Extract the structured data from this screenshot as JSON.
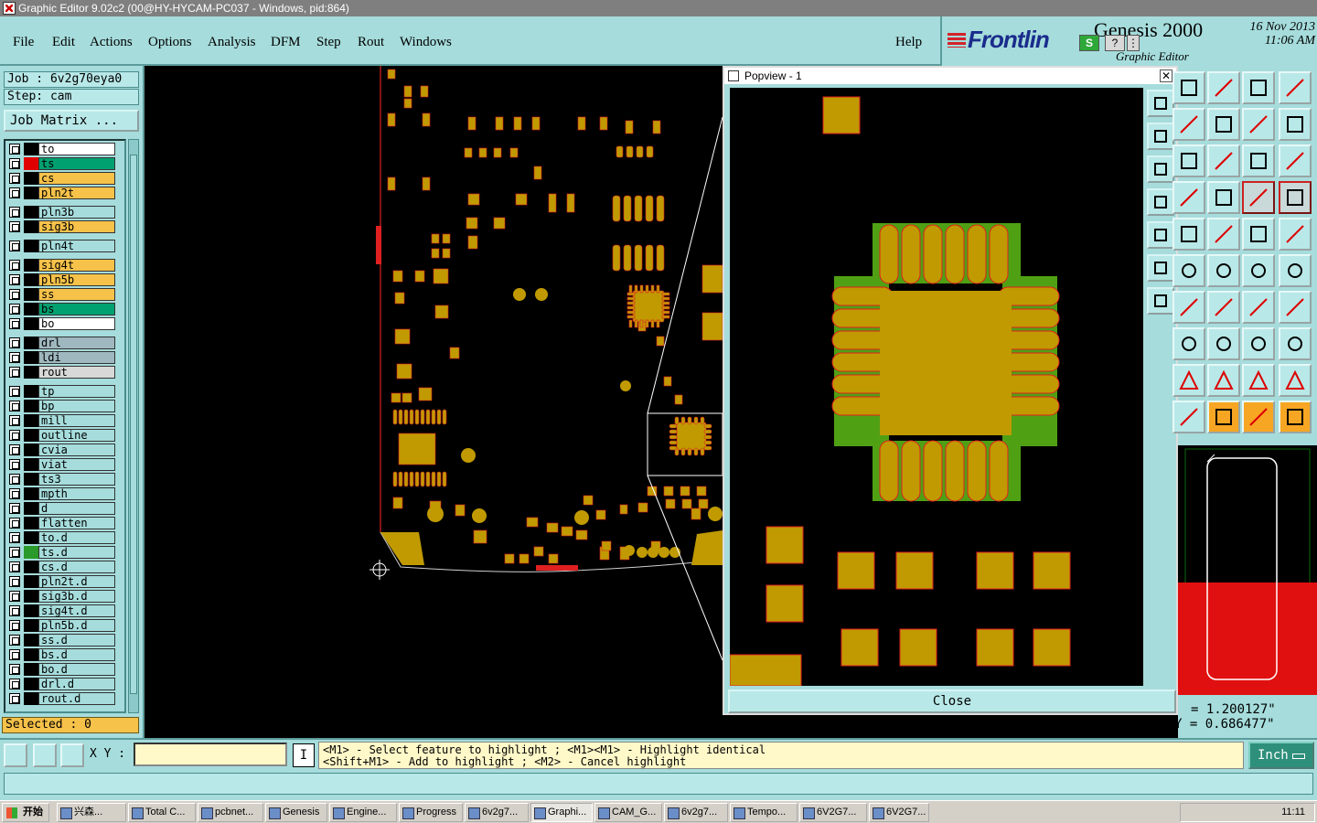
{
  "window": {
    "title": "Graphic Editor 9.02c2 (00@HY-HYCAM-PC037 - Windows, pid:864)"
  },
  "menu": [
    "File",
    "Edit",
    "Actions",
    "Options",
    "Analysis",
    "DFM",
    "Step",
    "Rout",
    "Windows"
  ],
  "help_label": "Help",
  "brand": {
    "logo": "Frontlin",
    "product": "Genesis 2000",
    "subtitle": "Graphic Editor",
    "date": "16 Nov 2013",
    "time": "11:06 AM"
  },
  "job": {
    "label": "Job  : 6v2g70eya0",
    "step": "Step: cam",
    "matrix_button": "Job Matrix ..."
  },
  "layers": [
    {
      "name": "to",
      "color": "#ffffff",
      "sq": "#000000"
    },
    {
      "name": "ts",
      "color": "#00a070",
      "sq": "#e00000"
    },
    {
      "name": "cs",
      "color": "#f7c24a",
      "sq": "#000000"
    },
    {
      "name": "pln2t",
      "color": "#f7c24a",
      "sq": "#000000"
    },
    {
      "name": "pln3b",
      "color": "#a6dcdc",
      "sq": "#000000"
    },
    {
      "name": "sig3b",
      "color": "#f7c24a",
      "sq": "#000000"
    },
    {
      "name": "pln4t",
      "color": "#a6dcdc",
      "sq": "#000000"
    },
    {
      "name": "sig4t",
      "color": "#f7c24a",
      "sq": "#000000"
    },
    {
      "name": "pln5b",
      "color": "#f7c24a",
      "sq": "#000000"
    },
    {
      "name": "ss",
      "color": "#f7c24a",
      "sq": "#000000"
    },
    {
      "name": "bs",
      "color": "#00a070",
      "sq": "#000000"
    },
    {
      "name": "bo",
      "color": "#ffffff",
      "sq": "#000000"
    },
    {
      "name": "drl",
      "color": "#9fb8c0",
      "sq": "#000000"
    },
    {
      "name": "ldi",
      "color": "#9fb8c0",
      "sq": "#000000"
    },
    {
      "name": "rout",
      "color": "#d8d8d8",
      "sq": "#000000"
    },
    {
      "name": "tp",
      "color": "#a6dcdc",
      "sq": "#000000"
    },
    {
      "name": "bp",
      "color": "#a6dcdc",
      "sq": "#000000"
    },
    {
      "name": "mill",
      "color": "#a6dcdc",
      "sq": "#000000"
    },
    {
      "name": "outline",
      "color": "#a6dcdc",
      "sq": "#000000"
    },
    {
      "name": "cvia",
      "color": "#a6dcdc",
      "sq": "#000000"
    },
    {
      "name": "viat",
      "color": "#a6dcdc",
      "sq": "#000000"
    },
    {
      "name": "ts3",
      "color": "#a6dcdc",
      "sq": "#000000"
    },
    {
      "name": "mpth",
      "color": "#a6dcdc",
      "sq": "#000000"
    },
    {
      "name": "d",
      "color": "#a6dcdc",
      "sq": "#000000"
    },
    {
      "name": "flatten",
      "color": "#a6dcdc",
      "sq": "#000000"
    },
    {
      "name": "to.d",
      "color": "#a6dcdc",
      "sq": "#000000"
    },
    {
      "name": "ts.d",
      "color": "#a6dcdc",
      "sq": "#2a9a2a"
    },
    {
      "name": "cs.d",
      "color": "#a6dcdc",
      "sq": "#000000"
    },
    {
      "name": "pln2t.d",
      "color": "#a6dcdc",
      "sq": "#000000"
    },
    {
      "name": "sig3b.d",
      "color": "#a6dcdc",
      "sq": "#000000"
    },
    {
      "name": "sig4t.d",
      "color": "#a6dcdc",
      "sq": "#000000"
    },
    {
      "name": "pln5b.d",
      "color": "#a6dcdc",
      "sq": "#000000"
    },
    {
      "name": "ss.d",
      "color": "#a6dcdc",
      "sq": "#000000"
    },
    {
      "name": "bs.d",
      "color": "#a6dcdc",
      "sq": "#000000"
    },
    {
      "name": "bo.d",
      "color": "#a6dcdc",
      "sq": "#000000"
    },
    {
      "name": "drl.d",
      "color": "#a6dcdc",
      "sq": "#000000"
    },
    {
      "name": "rout.d",
      "color": "#a6dcdc",
      "sq": "#000000"
    }
  ],
  "selected": "Selected : 0",
  "popview": {
    "title": "Popview - 1",
    "close_label": "Close",
    "close_x": "✕"
  },
  "coords": {
    "x": "= 1.200127\"",
    "y": "Y = 0.686477\""
  },
  "xy_label": "X Y :",
  "xy_value": "",
  "info_glyph": "I",
  "hint_line1": "<M1> - Select feature to highlight ; <M1><M1> - Highlight identical",
  "hint_line2": "<Shift+M1> - Add to highlight ; <M2> - Cancel highlight",
  "unit": "Inch",
  "taskbar": {
    "start": "开始",
    "tasks": [
      "兴森...",
      "Total C...",
      "pcbnet...",
      "Genesis",
      "Engine...",
      "Progress",
      "6v2g7...",
      "Graphi...",
      "CAM_G...",
      "6v2g7...",
      "Tempo...",
      "6V2G7...",
      "6V2G7..."
    ],
    "clock": "11:11"
  },
  "colors": {
    "copper": "#c09a00",
    "mask": "#50a014",
    "outline": "#e02020",
    "panel": "#a6dcdc"
  }
}
